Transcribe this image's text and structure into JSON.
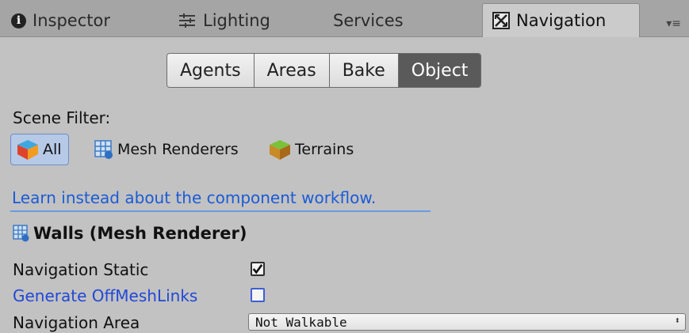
{
  "tabs": [
    {
      "label": "Inspector",
      "icon": "info-icon"
    },
    {
      "label": "Lighting",
      "icon": "sliders-icon"
    },
    {
      "label": "Services",
      "icon": ""
    },
    {
      "label": "Navigation",
      "icon": "navigation-icon",
      "active": true
    }
  ],
  "toolbar": {
    "segments": [
      "Agents",
      "Areas",
      "Bake",
      "Object"
    ],
    "active": "Object"
  },
  "scene_filter": {
    "label": "Scene Filter:",
    "options": [
      {
        "label": "All",
        "icon": "cube-icon",
        "selected": true
      },
      {
        "label": "Mesh Renderers",
        "icon": "mesh-renderer-icon"
      },
      {
        "label": "Terrains",
        "icon": "terrain-icon"
      }
    ]
  },
  "learn_link": "Learn instead about the component workflow.",
  "object": {
    "title": "Walls (Mesh Renderer)",
    "icon": "mesh-renderer-icon"
  },
  "fields": {
    "navigation_static": {
      "label": "Navigation Static",
      "checked": true
    },
    "generate_offmeshlinks": {
      "label": "Generate OffMeshLinks",
      "checked": false
    },
    "navigation_area": {
      "label": "Navigation Area",
      "value": "Not Walkable"
    }
  },
  "colors": {
    "panel_bg": "#c2c2c2",
    "link": "#1b5bd6",
    "selected_filter": "#b6c9e6",
    "active_segment": "#5a5a5a"
  }
}
